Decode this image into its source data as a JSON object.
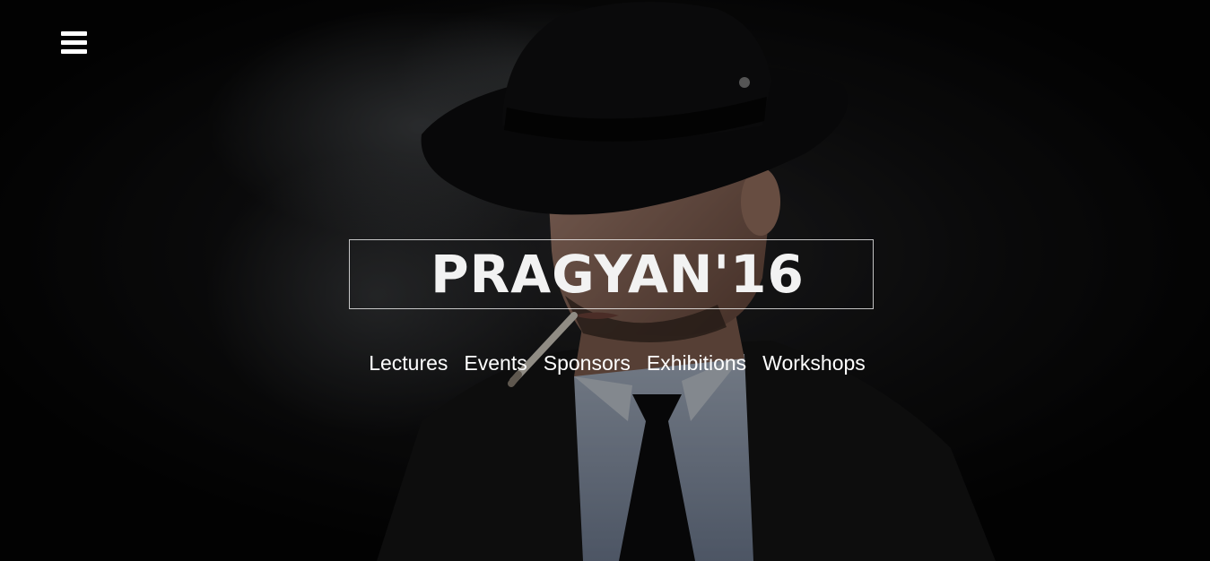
{
  "header": {
    "menu_icon": "hamburger-menu-icon"
  },
  "hero": {
    "title": "PRAGYAN'16",
    "background_image": "man-in-fedora-smoking-cigarette",
    "nav_links": [
      {
        "label": "Lectures"
      },
      {
        "label": "Events"
      },
      {
        "label": "Sponsors"
      },
      {
        "label": "Exhibitions"
      },
      {
        "label": "Workshops"
      }
    ]
  },
  "colors": {
    "background": "#050505",
    "text": "#ffffff",
    "title_border": "#bfbfbf"
  }
}
